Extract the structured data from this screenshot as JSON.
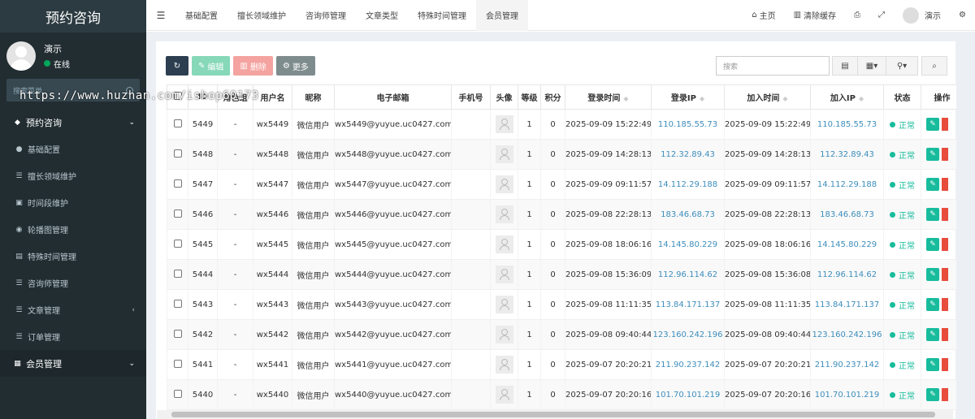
{
  "app": {
    "title": "预约咨询"
  },
  "user": {
    "name": "演示",
    "status": "在线"
  },
  "sidebar": {
    "search_placeholder": "搜索菜单",
    "items": [
      {
        "label": "预约咨询",
        "icon": "cubes-icon"
      },
      {
        "label": "基础配置",
        "icon": "map-marker-icon"
      },
      {
        "label": "擅长领域维护",
        "icon": "list-icon"
      },
      {
        "label": "时间段维护",
        "icon": "image-icon"
      },
      {
        "label": "轮播图管理",
        "icon": "compass-icon"
      },
      {
        "label": "特殊时间管理",
        "icon": "file-icon"
      },
      {
        "label": "咨询师管理",
        "icon": "list-icon"
      },
      {
        "label": "文章管理",
        "icon": "list-icon"
      },
      {
        "label": "订单管理",
        "icon": "list-icon"
      },
      {
        "label": "会员管理",
        "icon": "table-icon"
      }
    ]
  },
  "watermark": "https://www.huzhan.com/ishop60173",
  "topbar": {
    "tabs": [
      "基础配置",
      "擅长领域维护",
      "咨询师管理",
      "文章类型",
      "特殊时间管理",
      "会员管理"
    ],
    "active_tab": 5,
    "home": "主页",
    "clear_cache": "清除缓存",
    "username": "演示"
  },
  "toolbar": {
    "edit": "编辑",
    "delete": "删除",
    "more": "更多",
    "search_placeholder": "搜索"
  },
  "table": {
    "columns": [
      "",
      "ID",
      "角色组",
      "用户名",
      "昵称",
      "电子邮箱",
      "手机号",
      "头像",
      "等级",
      "积分",
      "登录时间",
      "登录IP",
      "加入时间",
      "加入IP",
      "状态",
      "操作"
    ],
    "rows": [
      {
        "id": "5449",
        "group": "-",
        "username": "wx5449",
        "nickname": "微信用户",
        "email": "wx5449@yuyue.uc0427.com",
        "mobile": "",
        "level": "1",
        "score": "0",
        "login_time": "2025-09-09 15:22:49",
        "login_ip": "110.185.55.73",
        "join_time": "2025-09-09 15:22:49",
        "join_ip": "110.185.55.73",
        "status": "正常"
      },
      {
        "id": "5448",
        "group": "-",
        "username": "wx5448",
        "nickname": "微信用户",
        "email": "wx5448@yuyue.uc0427.com",
        "mobile": "",
        "level": "1",
        "score": "0",
        "login_time": "2025-09-09 14:28:13",
        "login_ip": "112.32.89.43",
        "join_time": "2025-09-09 14:28:13",
        "join_ip": "112.32.89.43",
        "status": "正常"
      },
      {
        "id": "5447",
        "group": "-",
        "username": "wx5447",
        "nickname": "微信用户",
        "email": "wx5447@yuyue.uc0427.com",
        "mobile": "",
        "level": "1",
        "score": "0",
        "login_time": "2025-09-09 09:11:57",
        "login_ip": "14.112.29.188",
        "join_time": "2025-09-09 09:11:57",
        "join_ip": "14.112.29.188",
        "status": "正常"
      },
      {
        "id": "5446",
        "group": "-",
        "username": "wx5446",
        "nickname": "微信用户",
        "email": "wx5446@yuyue.uc0427.com",
        "mobile": "",
        "level": "1",
        "score": "0",
        "login_time": "2025-09-08 22:28:13",
        "login_ip": "183.46.68.73",
        "join_time": "2025-09-08 22:28:13",
        "join_ip": "183.46.68.73",
        "status": "正常"
      },
      {
        "id": "5445",
        "group": "-",
        "username": "wx5445",
        "nickname": "微信用户",
        "email": "wx5445@yuyue.uc0427.com",
        "mobile": "",
        "level": "1",
        "score": "0",
        "login_time": "2025-09-08 18:06:16",
        "login_ip": "14.145.80.229",
        "join_time": "2025-09-08 18:06:16",
        "join_ip": "14.145.80.229",
        "status": "正常"
      },
      {
        "id": "5444",
        "group": "-",
        "username": "wx5444",
        "nickname": "微信用户",
        "email": "wx5444@yuyue.uc0427.com",
        "mobile": "",
        "level": "1",
        "score": "0",
        "login_time": "2025-09-08 15:36:09",
        "login_ip": "112.96.114.62",
        "join_time": "2025-09-08 15:36:08",
        "join_ip": "112.96.114.62",
        "status": "正常"
      },
      {
        "id": "5443",
        "group": "-",
        "username": "wx5443",
        "nickname": "微信用户",
        "email": "wx5443@yuyue.uc0427.com",
        "mobile": "",
        "level": "1",
        "score": "0",
        "login_time": "2025-09-08 11:11:35",
        "login_ip": "113.84.171.137",
        "join_time": "2025-09-08 11:11:35",
        "join_ip": "113.84.171.137",
        "status": "正常"
      },
      {
        "id": "5442",
        "group": "-",
        "username": "wx5442",
        "nickname": "微信用户",
        "email": "wx5442@yuyue.uc0427.com",
        "mobile": "",
        "level": "1",
        "score": "0",
        "login_time": "2025-09-08 09:40:44",
        "login_ip": "123.160.242.196",
        "join_time": "2025-09-08 09:40:44",
        "join_ip": "123.160.242.196",
        "status": "正常"
      },
      {
        "id": "5441",
        "group": "-",
        "username": "wx5441",
        "nickname": "微信用户",
        "email": "wx5441@yuyue.uc0427.com",
        "mobile": "",
        "level": "1",
        "score": "0",
        "login_time": "2025-09-07 20:20:21",
        "login_ip": "211.90.237.142",
        "join_time": "2025-09-07 20:20:21",
        "join_ip": "211.90.237.142",
        "status": "正常"
      },
      {
        "id": "5440",
        "group": "-",
        "username": "wx5440",
        "nickname": "微信用户",
        "email": "wx5440@yuyue.uc0427.com",
        "mobile": "",
        "level": "1",
        "score": "0",
        "login_time": "2025-09-07 20:20:16",
        "login_ip": "101.70.101.219",
        "join_time": "2025-09-07 20:20:16",
        "join_ip": "101.70.101.219",
        "status": "正常"
      }
    ]
  },
  "colors": {
    "sidebar_bg": "#222d32",
    "accent": "#18bc9c",
    "danger": "#e74c3c",
    "link": "#3c8dbc"
  }
}
